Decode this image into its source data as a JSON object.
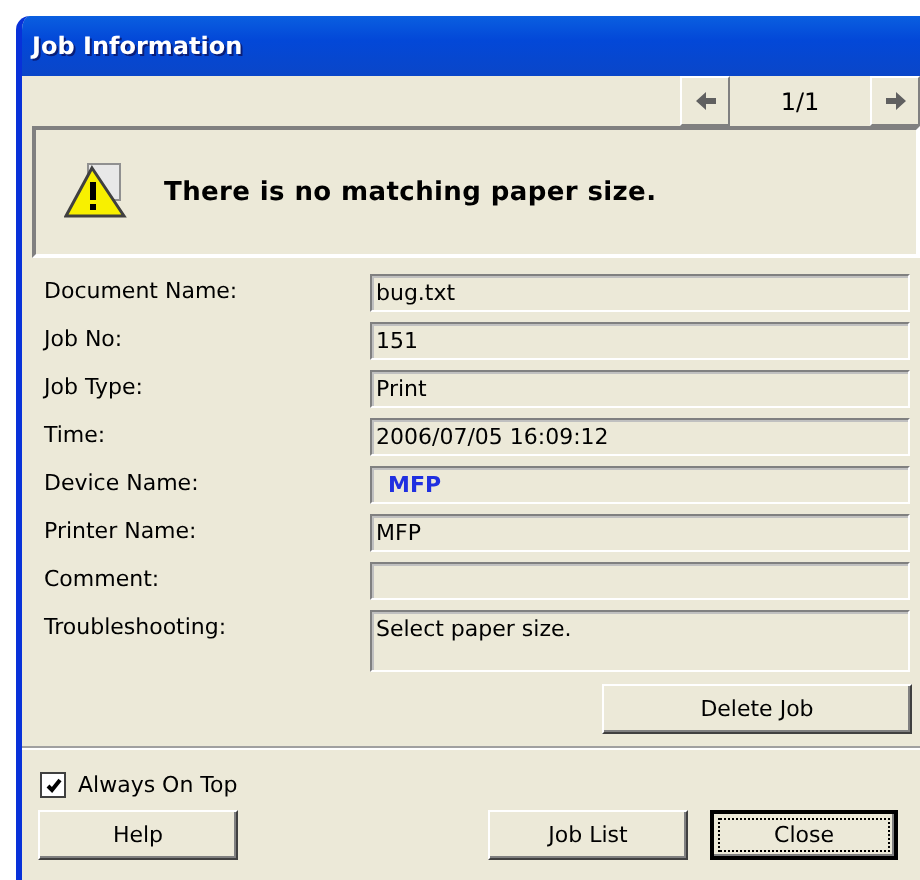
{
  "window": {
    "title": "Job Information"
  },
  "pager": {
    "text": "1/1"
  },
  "message": {
    "text": "There is no matching paper size."
  },
  "fields": [
    {
      "label": "Document Name:",
      "value": "bug.txt",
      "kind": "text"
    },
    {
      "label": "Job No:",
      "value": "151",
      "kind": "text"
    },
    {
      "label": "Job Type:",
      "value": "Print",
      "kind": "text"
    },
    {
      "label": "Time:",
      "value": "2006/07/05 16:09:12",
      "kind": "text"
    },
    {
      "label": "Device Name:",
      "value": "MFP",
      "kind": "link"
    },
    {
      "label": "Printer Name:",
      "value": "MFP",
      "kind": "text"
    },
    {
      "label": "Comment:",
      "kind": "text"
    },
    {
      "label": "Troubleshooting:",
      "value": "Select paper size.",
      "kind": "multiline"
    }
  ],
  "delete_button": "Delete Job",
  "always_on_top": {
    "label": "Always On Top",
    "checked": true
  },
  "buttons": [
    {
      "label": "Help",
      "focused": false
    },
    {
      "label": "Job List",
      "focused": false
    },
    {
      "label": "Close",
      "focused": true
    }
  ]
}
